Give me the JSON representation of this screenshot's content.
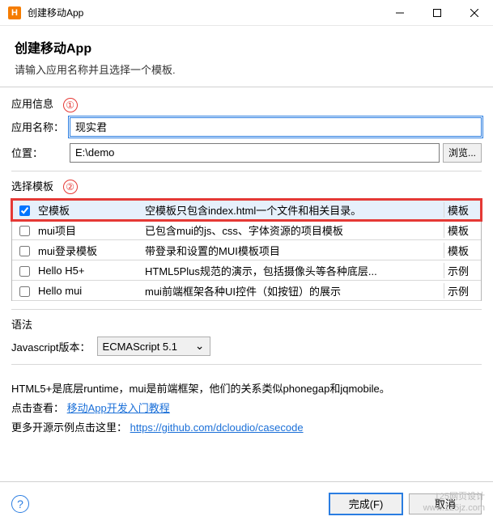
{
  "titlebar": {
    "icon_letter": "H",
    "title": "创建移动App"
  },
  "header": {
    "title": "创建移动App",
    "subtitle": "请输入应用名称并且选择一个模板."
  },
  "app_info": {
    "group_label": "应用信息",
    "marker": "①",
    "name_label": "应用名称：",
    "name_value": "现实君",
    "location_label": "位置：",
    "location_value": "E:\\demo",
    "browse_label": "浏览..."
  },
  "templates": {
    "group_label": "选择模板",
    "marker": "②",
    "rows": [
      {
        "checked": true,
        "name": "空模板",
        "desc": "空模板只包含index.html一个文件和相关目录。",
        "type": "模板"
      },
      {
        "checked": false,
        "name": "mui项目",
        "desc": "已包含mui的js、css、字体资源的项目模板",
        "type": "模板"
      },
      {
        "checked": false,
        "name": "mui登录模板",
        "desc": "带登录和设置的MUI模板项目",
        "type": "模板"
      },
      {
        "checked": false,
        "name": "Hello H5+",
        "desc": "HTML5Plus规范的演示，包括摄像头等各种底层...",
        "type": "示例"
      },
      {
        "checked": false,
        "name": "Hello mui",
        "desc": "mui前端框架各种UI控件（如按钮）的展示",
        "type": "示例"
      }
    ]
  },
  "syntax": {
    "group_label": "语法",
    "js_version_label": "Javascript版本：",
    "js_version_value": "ECMAScript 5.1"
  },
  "info": {
    "line1": "HTML5+是底层runtime，mui是前端框架，他们的关系类似phonegap和jqmobile。",
    "line2_prefix": "点击查看：",
    "line2_link": "移动App开发入门教程",
    "line3_prefix": "更多开源示例点击这里：",
    "line3_link": "https://github.com/dcloudio/casecode"
  },
  "footer": {
    "finish": "完成(F)",
    "cancel": "取消"
  },
  "watermark": {
    "l1": "125网页设计",
    "l2": "www.125jz.com"
  }
}
